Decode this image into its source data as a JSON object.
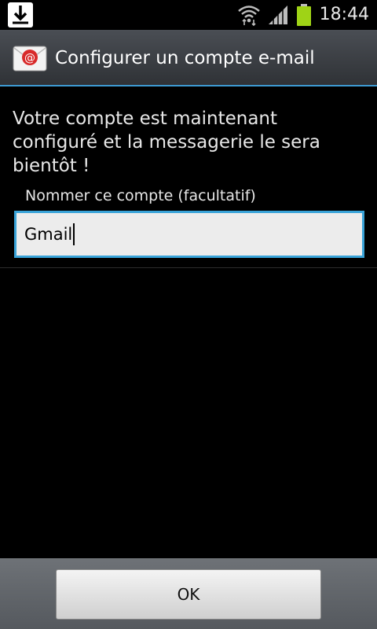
{
  "status_bar": {
    "time": "18:44",
    "icons": [
      "download-notification-icon",
      "wifi-icon",
      "signal-icon",
      "battery-icon"
    ],
    "battery_color": "#9fd316"
  },
  "title_bar": {
    "icon": "email-app-icon",
    "title": "Configurer un compte e-mail",
    "accent_color": "#3e9bd3"
  },
  "content": {
    "message": "Votre compte est maintenant configuré et la messagerie le sera bientôt !",
    "account_name_label": "Nommer ce compte (facultatif)",
    "account_name_value": "Gmail"
  },
  "footer": {
    "ok_label": "OK"
  }
}
